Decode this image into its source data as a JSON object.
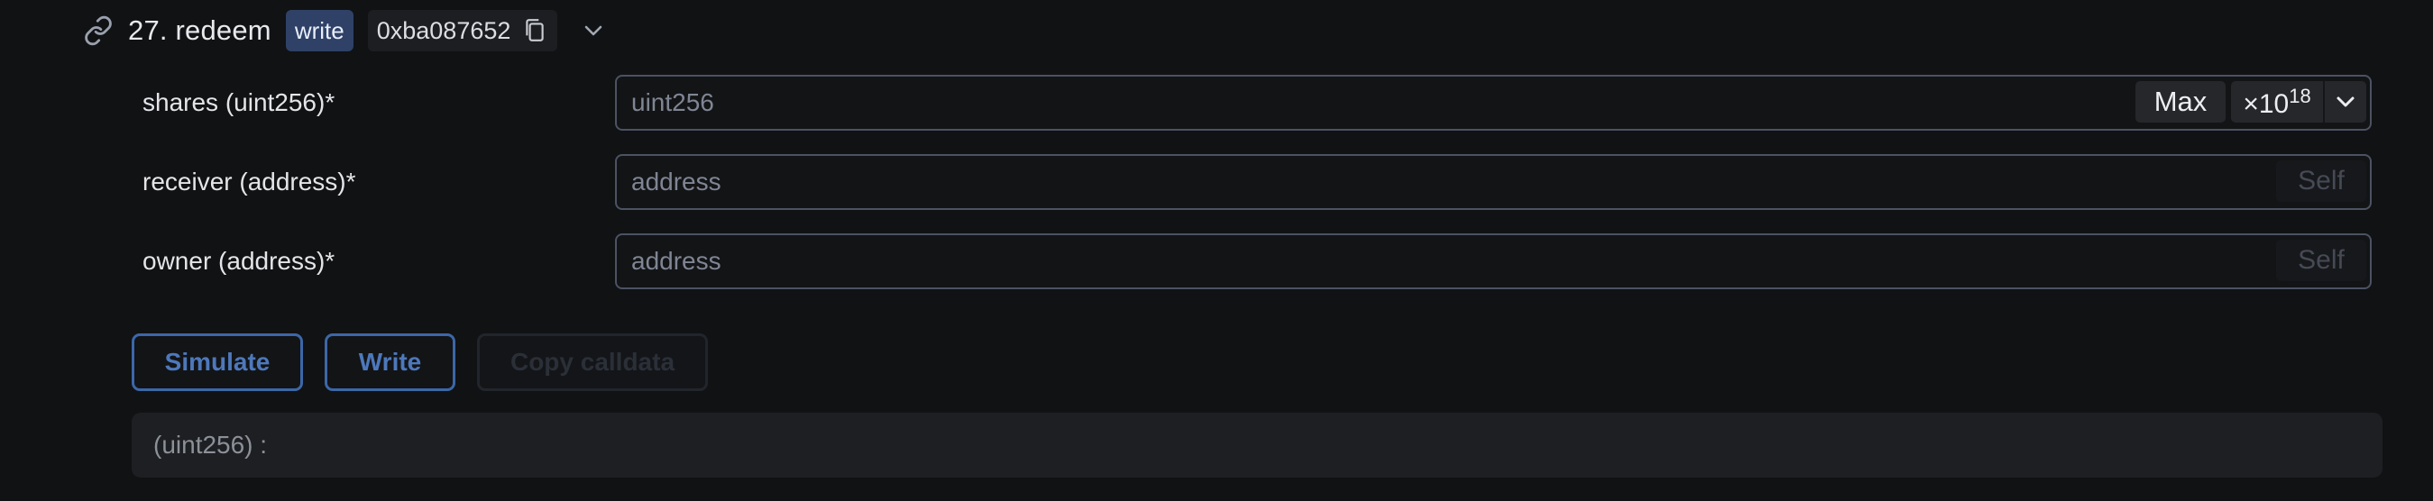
{
  "method": {
    "title": "27. redeem",
    "badge": "write",
    "address": "0xba087652"
  },
  "fields": [
    {
      "label": "shares (uint256)*",
      "placeholder": "uint256",
      "max_label": "Max",
      "unit_base": "×10",
      "unit_exp": "18"
    },
    {
      "label": "receiver (address)*",
      "placeholder": "address",
      "self_label": "Self"
    },
    {
      "label": "owner (address)*",
      "placeholder": "address",
      "self_label": "Self"
    }
  ],
  "actions": {
    "simulate": "Simulate",
    "write": "Write",
    "copy_calldata": "Copy calldata"
  },
  "output": {
    "text": "(uint256) :"
  },
  "icons": {
    "link": "link-icon",
    "copy": "copy-icon",
    "chevron": "chevron-down-icon"
  },
  "colors": {
    "background": "#111214",
    "badge_bg": "#2f4166",
    "accent": "#3c67a8",
    "field_border": "#4c5263"
  }
}
